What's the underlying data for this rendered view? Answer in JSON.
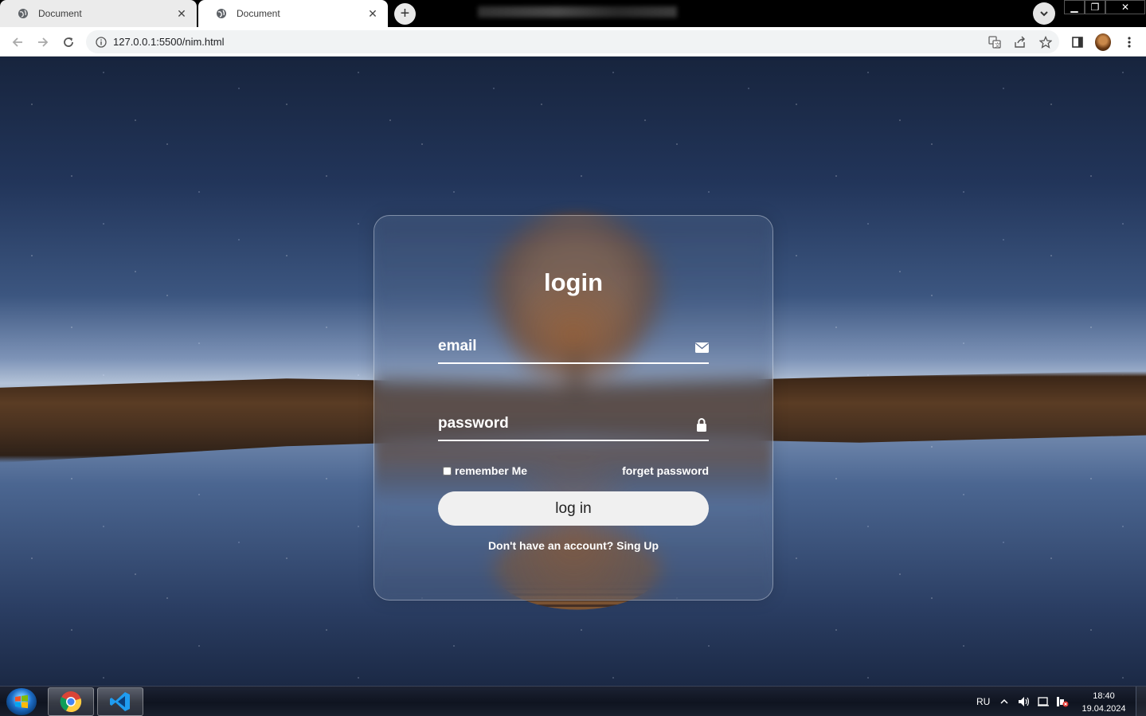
{
  "browser": {
    "tabs": [
      {
        "title": "Document",
        "active": false
      },
      {
        "title": "Document",
        "active": true
      }
    ],
    "new_tab": "+",
    "url": "127.0.0.1:5500/nim.html"
  },
  "login": {
    "title": "login",
    "email_placeholder": "email",
    "password_placeholder": "password",
    "remember_label": "remember Me",
    "forgot_label": "forget password",
    "submit_label": "log in",
    "register_text": "Don't have an account? Sing Up"
  },
  "taskbar": {
    "language": "RU",
    "time": "18:40",
    "date": "19.04.2024"
  }
}
